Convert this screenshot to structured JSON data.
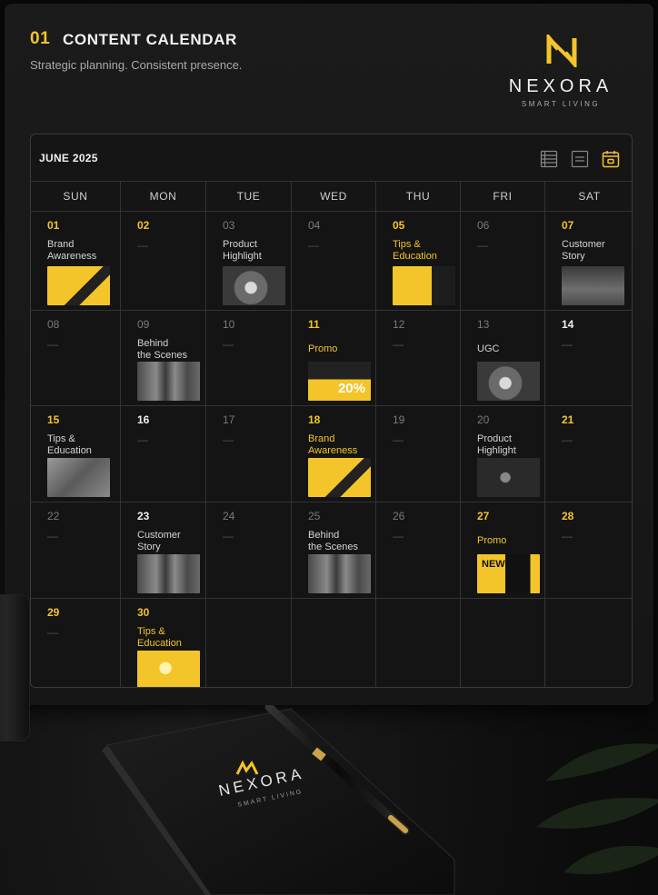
{
  "header": {
    "number": "01",
    "title": "CONTENT CALENDAR",
    "subtitle": "Strategic planning. Consistent presence."
  },
  "brand": {
    "name": "NEXORA",
    "tagline": "SMART LIVING",
    "accent": "#f3c52a"
  },
  "calendar": {
    "month": "JUNE 2025",
    "views": [
      "list-view-icon",
      "agenda-view-icon",
      "calendar-view-icon"
    ],
    "active_view": "calendar-view-icon",
    "weekdays": [
      "SUN",
      "MON",
      "TUE",
      "WED",
      "THU",
      "FRI",
      "SAT"
    ],
    "weeks": [
      [
        {
          "day": "01",
          "label": "Brand\nAwareness",
          "tone": "hi",
          "thumb": "yellow-desk"
        },
        {
          "day": "02",
          "tone": "hi"
        },
        {
          "day": "03",
          "label": "Product\nHighlight",
          "tone": "dim",
          "thumb": "grey-device"
        },
        {
          "day": "04",
          "tone": "dim"
        },
        {
          "day": "05",
          "label": "Tips &\nEducation",
          "tone": "hi",
          "label_tone": "y",
          "thumb": "yellow-split"
        },
        {
          "day": "06",
          "tone": "dim"
        },
        {
          "day": "07",
          "label": "Customer\nStory",
          "tone": "hi",
          "thumb": "grey-people"
        }
      ],
      [
        {
          "day": "08",
          "tone": "dim"
        },
        {
          "day": "09",
          "label": "Behind\nthe Scenes",
          "tone": "dim",
          "thumb": "grey-team"
        },
        {
          "day": "10",
          "tone": "dim"
        },
        {
          "day": "11",
          "label": "Promo",
          "tone": "hi",
          "label_tone": "y",
          "thumb": "promo-20",
          "thumb_text": "20%"
        },
        {
          "day": "12",
          "tone": "dim"
        },
        {
          "day": "13",
          "label": "UGC",
          "tone": "dim",
          "thumb": "grey-device"
        },
        {
          "day": "14",
          "tone": "wh"
        }
      ],
      [
        {
          "day": "15",
          "label": "Tips &\nEducation",
          "tone": "hi",
          "thumb": "grey-room"
        },
        {
          "day": "16",
          "tone": "wh"
        },
        {
          "day": "17",
          "tone": "dim"
        },
        {
          "day": "18",
          "label": "Brand\nAwareness",
          "tone": "hi",
          "label_tone": "y",
          "thumb": "yellow-desk"
        },
        {
          "day": "19",
          "tone": "dim"
        },
        {
          "day": "20",
          "label": "Product\nHighlight",
          "tone": "dim",
          "thumb": "dark-device"
        },
        {
          "day": "21",
          "tone": "hi"
        }
      ],
      [
        {
          "day": "22",
          "tone": "dim"
        },
        {
          "day": "23",
          "label": "Customer\nStory",
          "tone": "wh",
          "thumb": "grey-team"
        },
        {
          "day": "24",
          "tone": "dim"
        },
        {
          "day": "25",
          "label": "Behind\nthe Scenes",
          "tone": "dim",
          "thumb": "grey-team"
        },
        {
          "day": "26",
          "tone": "dim"
        },
        {
          "day": "27",
          "label": "Promo",
          "tone": "hi",
          "label_tone": "y",
          "thumb": "promo-new",
          "thumb_text": "NEW"
        },
        {
          "day": "28",
          "tone": "hi"
        }
      ],
      [
        {
          "day": "29",
          "tone": "hi"
        },
        {
          "day": "30",
          "label": "Tips &\nEducation",
          "tone": "hi",
          "label_tone": "y",
          "thumb": "yellow-lamp"
        },
        {},
        {},
        {},
        {},
        {}
      ]
    ]
  },
  "notebook": {
    "brand_name": "NEXORA",
    "brand_tagline": "SMART LIVING"
  }
}
